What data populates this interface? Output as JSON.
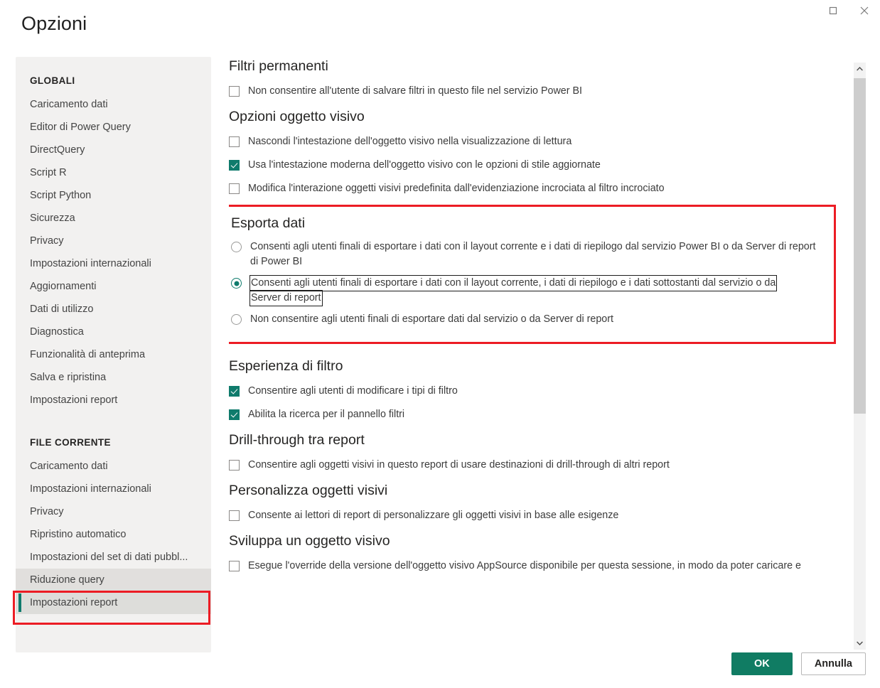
{
  "window": {
    "title": "Opzioni",
    "controls": [
      {
        "name": "maximize-button",
        "icon": "maximize-icon"
      },
      {
        "name": "close-button",
        "icon": "close-icon"
      }
    ]
  },
  "sidebar": {
    "groups": [
      {
        "title": "GLOBALI",
        "items": [
          {
            "label": "Caricamento dati",
            "state": "normal"
          },
          {
            "label": "Editor di Power Query",
            "state": "normal"
          },
          {
            "label": "DirectQuery",
            "state": "normal"
          },
          {
            "label": "Script R",
            "state": "normal"
          },
          {
            "label": "Script Python",
            "state": "normal"
          },
          {
            "label": "Sicurezza",
            "state": "normal"
          },
          {
            "label": "Privacy",
            "state": "normal"
          },
          {
            "label": "Impostazioni internazionali",
            "state": "normal"
          },
          {
            "label": "Aggiornamenti",
            "state": "normal"
          },
          {
            "label": "Dati di utilizzo",
            "state": "normal"
          },
          {
            "label": "Diagnostica",
            "state": "normal"
          },
          {
            "label": "Funzionalità di anteprima",
            "state": "normal"
          },
          {
            "label": "Salva e ripristina",
            "state": "normal"
          },
          {
            "label": "Impostazioni report",
            "state": "normal"
          }
        ]
      },
      {
        "title": "FILE CORRENTE",
        "items": [
          {
            "label": "Caricamento dati",
            "state": "normal"
          },
          {
            "label": "Impostazioni internazionali",
            "state": "normal"
          },
          {
            "label": "Privacy",
            "state": "normal"
          },
          {
            "label": "Ripristino automatico",
            "state": "normal"
          },
          {
            "label": "Impostazioni del set di dati pubbl...",
            "state": "normal"
          },
          {
            "label": "Riduzione query",
            "state": "hovered"
          },
          {
            "label": "Impostazioni report",
            "state": "selected"
          }
        ]
      }
    ]
  },
  "content": {
    "sections": [
      {
        "title": "Filtri permanenti",
        "type": "checkbox",
        "highlighted": false,
        "options": [
          {
            "label": "Non consentire all'utente di salvare filtri in questo file nel servizio Power BI",
            "checked": false
          }
        ]
      },
      {
        "title": "Opzioni oggetto visivo",
        "type": "checkbox",
        "highlighted": false,
        "options": [
          {
            "label": "Nascondi l'intestazione dell'oggetto visivo nella visualizzazione di lettura",
            "checked": false
          },
          {
            "label": "Usa l'intestazione moderna dell'oggetto visivo con le opzioni di stile aggiornate",
            "checked": true
          },
          {
            "label": "Modifica l'interazione oggetti visivi predefinita dall'evidenziazione incrociata al filtro incrociato",
            "checked": false
          }
        ]
      },
      {
        "title": "Esporta dati",
        "type": "radio",
        "highlighted": true,
        "options": [
          {
            "label": "Consenti agli utenti finali di esportare i dati con il layout corrente e i dati di riepilogo dal servizio Power BI o da Server di report di Power BI",
            "checked": false,
            "focused": false
          },
          {
            "label": "Consenti agli utenti finali di esportare i dati con il layout corrente, i dati di riepilogo e i dati sottostanti dal servizio o da Server di report",
            "line1": "Consenti agli utenti finali di esportare i dati con il layout corrente, i dati di riepilogo e i dati sottostanti dal servizio o da",
            "line2": "Server di report",
            "checked": true,
            "focused": true
          },
          {
            "label": "Non consentire agli utenti finali di esportare dati dal servizio o da Server di report",
            "checked": false,
            "focused": false
          }
        ]
      },
      {
        "title": "Esperienza di filtro",
        "type": "checkbox",
        "highlighted": false,
        "options": [
          {
            "label": "Consentire agli utenti di modificare i tipi di filtro",
            "checked": true
          },
          {
            "label": "Abilita la ricerca per il pannello filtri",
            "checked": true
          }
        ]
      },
      {
        "title": "Drill-through tra report",
        "type": "checkbox",
        "highlighted": false,
        "options": [
          {
            "label": "Consentire agli oggetti visivi in questo report di usare destinazioni di drill-through di altri report",
            "checked": false
          }
        ]
      },
      {
        "title": "Personalizza oggetti visivi",
        "type": "checkbox",
        "highlighted": false,
        "options": [
          {
            "label": "Consente ai lettori di report di personalizzare gli oggetti visivi in base alle esigenze",
            "checked": false
          }
        ]
      },
      {
        "title": "Sviluppa un oggetto visivo",
        "type": "checkbox",
        "highlighted": false,
        "options": [
          {
            "label": "Esegue l'override della versione dell'oggetto visivo AppSource disponibile per questa sessione, in modo da poter caricare e",
            "checked": false
          }
        ]
      }
    ]
  },
  "footer": {
    "ok_label": "OK",
    "cancel_label": "Annulla"
  },
  "colors": {
    "accent": "#107c63",
    "highlight": "#ec1c24",
    "sidebar_bg": "#f2f1f0",
    "selected_bg": "#ddddda"
  }
}
